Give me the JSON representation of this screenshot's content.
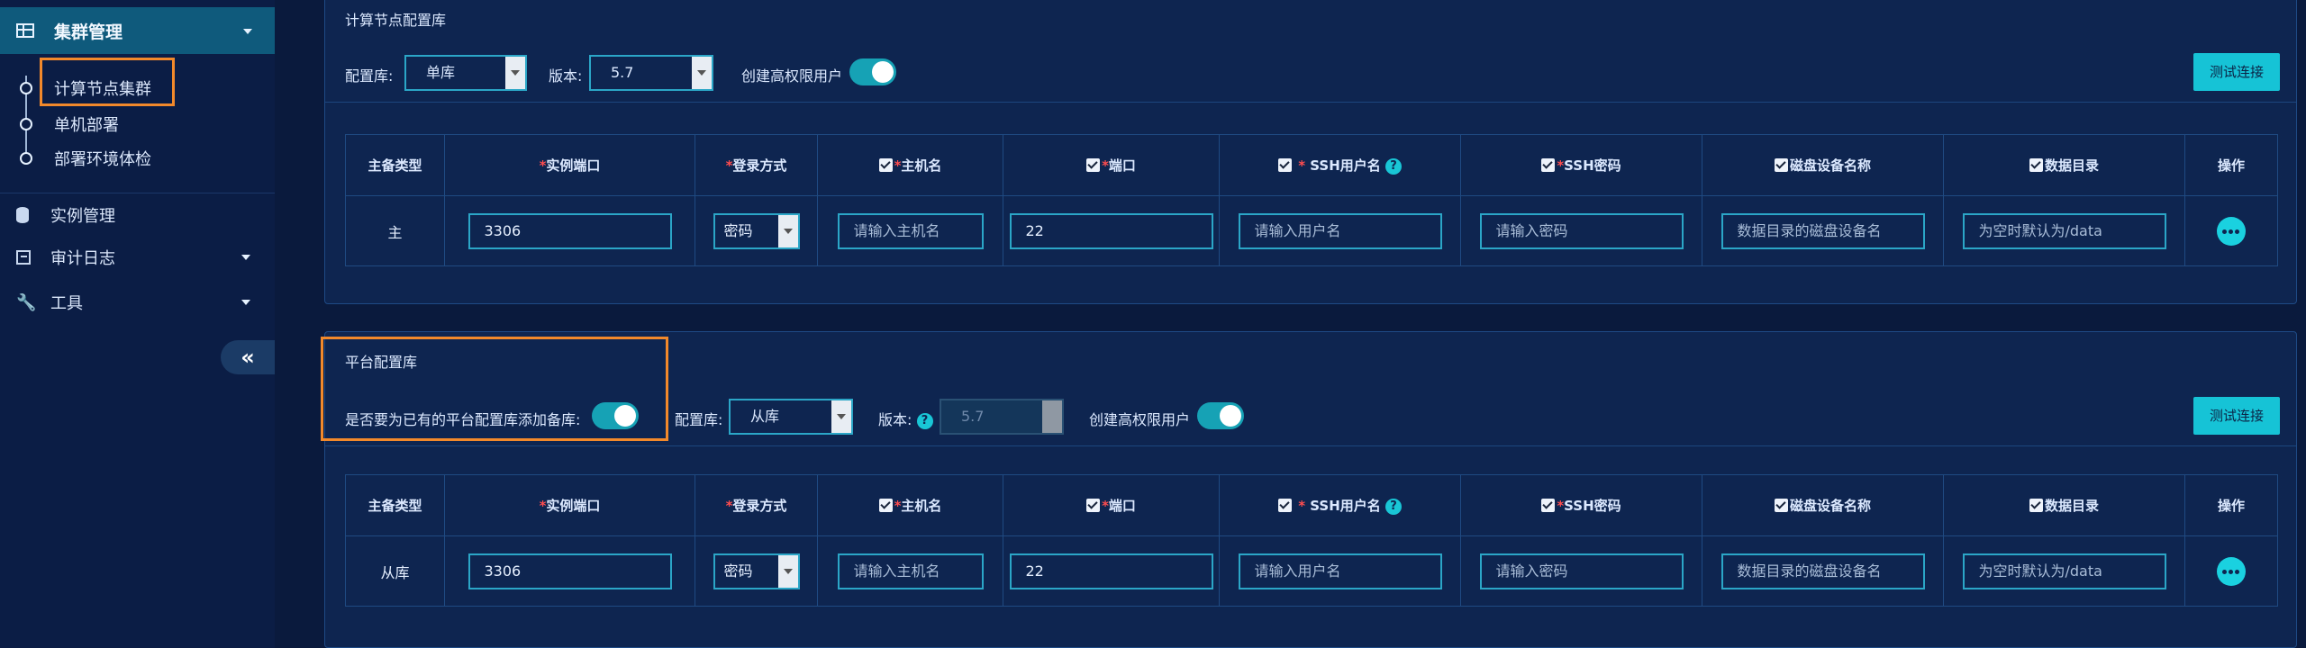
{
  "sidebar": {
    "cluster_mgmt": "集群管理",
    "sub_items": [
      "计算节点集群",
      "单机部署",
      "部署环境体检"
    ],
    "instance_mgmt": "实例管理",
    "audit_log": "审计日志",
    "tools": "工具",
    "collapse": "«"
  },
  "panel1": {
    "title": "计算节点配置库",
    "config_lib_label": "配置库:",
    "config_lib_value": "单库",
    "version_label": "版本:",
    "version_value": "5.7",
    "create_admin_label": "创建高权限用户",
    "create_admin_on": true,
    "test_btn": "测试连接"
  },
  "panel2": {
    "title": "平台配置库",
    "add_backup_label": "是否要为已有的平台配置库添加备库:",
    "add_backup_on": true,
    "config_lib_label": "配置库:",
    "config_lib_value": "从库",
    "version_label": "版本:",
    "version_value": "5.7",
    "create_admin_label": "创建高权限用户",
    "create_admin_on": true,
    "test_btn": "测试连接"
  },
  "table_headers": {
    "role": "主备类型",
    "inst_port": "实例端口",
    "login": "登录方式",
    "host": "主机名",
    "port": "端口",
    "ssh_user": "SSH用户名",
    "ssh_pwd": "SSH密码",
    "disk": "磁盘设备名称",
    "data_dir": "数据目录",
    "action": "操作",
    "required_mark": "*"
  },
  "row1": {
    "role": "主",
    "inst_port": "3306",
    "login": "密码",
    "host_ph": "请输入主机名",
    "port": "22",
    "ssh_user_ph": "请输入用户名",
    "ssh_pwd_ph": "请输入密码",
    "disk_ph": "数据目录的磁盘设备名",
    "data_dir_ph": "为空时默认为/data"
  },
  "row2": {
    "role": "从库",
    "inst_port": "3306",
    "login": "密码",
    "host_ph": "请输入主机名",
    "port": "22",
    "ssh_user_ph": "请输入用户名",
    "ssh_pwd_ph": "请输入密码",
    "disk_ph": "数据目录的磁盘设备名",
    "data_dir_ph": "为空时默认为/data"
  },
  "colors": {
    "accent": "#16c3d6",
    "highlight_box": "#f2892b",
    "required": "#ff4d4f"
  }
}
